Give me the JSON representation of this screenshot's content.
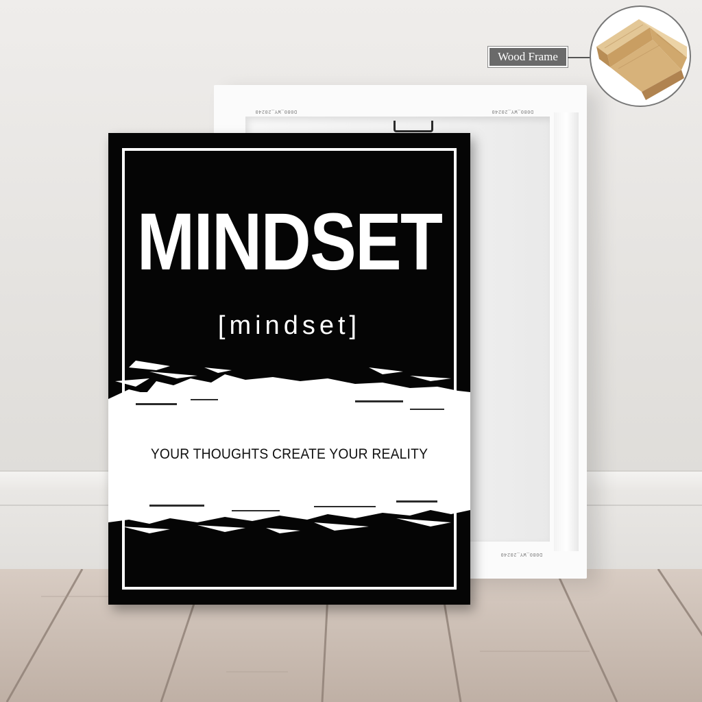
{
  "poster": {
    "title": "MINDSET",
    "subtitle": "[mindset]",
    "tagline": "YOUR THOUGHTS CREATE YOUR REALITY"
  },
  "callout": {
    "label": "Wood Frame",
    "icon": "wood-frame-corner-icon"
  },
  "back_canvas": {
    "label": "D080_WY_20240"
  },
  "colors": {
    "poster_bg": "#050505",
    "poster_text": "#ffffff",
    "tagline_text": "#111111",
    "wall": "#e6e4e2",
    "floor": "#cdbfb5",
    "wood": "#d9b98a"
  }
}
